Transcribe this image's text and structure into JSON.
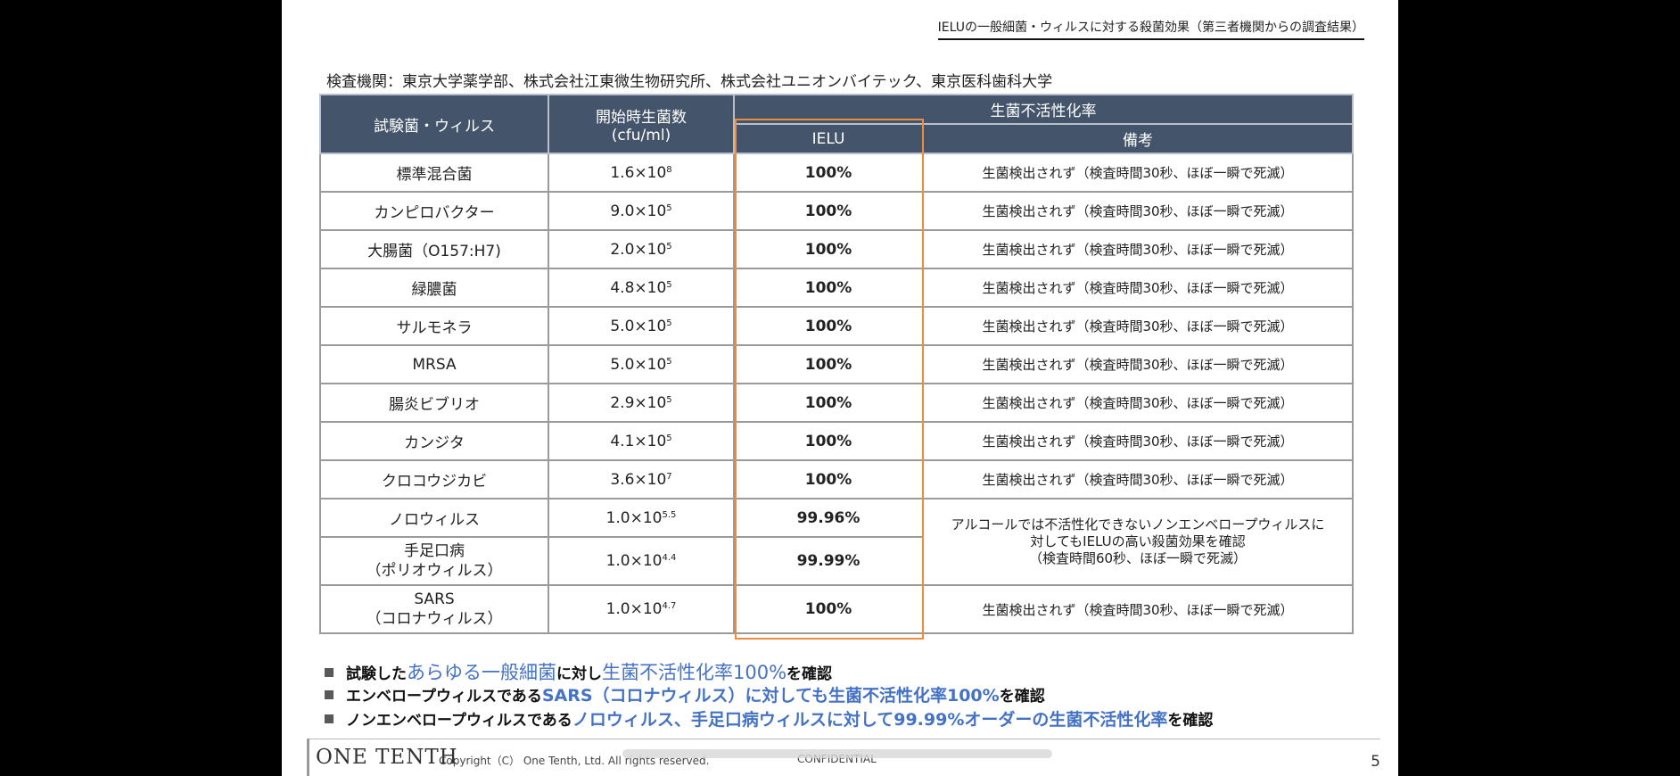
{
  "header": {
    "title": "IELUの一般細菌・ウィルスに対する殺菌効果（第三者機関からの調査結果）"
  },
  "organizations": "検査機関：東京大学薬学部、株式会社江東微生物研究所、株式会社ユニオンバイテック、東京医科歯科大学",
  "table": {
    "headers": {
      "bacteria": "試験菌・ウィルス",
      "initial_count_line1": "開始時生菌数",
      "initial_count_line2": "(cfu/ml)",
      "inactivation": "生菌不活性化率",
      "ielu": "IELU",
      "remarks": "備考"
    },
    "rows": [
      {
        "name": "標準混合菌",
        "coef": "1.6",
        "exp": "8",
        "rate": "100%",
        "note": "生菌検出されず（検査時間30秒、ほぼ一瞬で死滅）"
      },
      {
        "name": "カンピロバクター",
        "coef": "9.0",
        "exp": "5",
        "rate": "100%",
        "note": "生菌検出されず（検査時間30秒、ほぼ一瞬で死滅）"
      },
      {
        "name": "大腸菌（O157:H7)",
        "coef": "2.0",
        "exp": "5",
        "rate": "100%",
        "note": "生菌検出されず（検査時間30秒、ほぼ一瞬で死滅）"
      },
      {
        "name": "緑膿菌",
        "coef": "4.8",
        "exp": "5",
        "rate": "100%",
        "note": "生菌検出されず（検査時間30秒、ほぼ一瞬で死滅）"
      },
      {
        "name": "サルモネラ",
        "coef": "5.0",
        "exp": "5",
        "rate": "100%",
        "note": "生菌検出されず（検査時間30秒、ほぼ一瞬で死滅）"
      },
      {
        "name": "MRSA",
        "coef": "5.0",
        "exp": "5",
        "rate": "100%",
        "note": "生菌検出されず（検査時間30秒、ほぼ一瞬で死滅）"
      },
      {
        "name": "腸炎ビブリオ",
        "coef": "2.9",
        "exp": "5",
        "rate": "100%",
        "note": "生菌検出されず（検査時間30秒、ほぼ一瞬で死滅）"
      },
      {
        "name": "カンジタ",
        "coef": "4.1",
        "exp": "5",
        "rate": "100%",
        "note": "生菌検出されず（検査時間30秒、ほぼ一瞬で死滅）"
      },
      {
        "name": "クロコウジカビ",
        "coef": "3.6",
        "exp": "7",
        "rate": "100%",
        "note": "生菌検出されず（検査時間30秒、ほぼ一瞬で死滅）"
      },
      {
        "name": "ノロウィルス",
        "coef": "1.0",
        "exp": "5.5",
        "rate": "99.96%"
      },
      {
        "name_line1": "手足口病",
        "name_line2": "（ポリオウィルス）",
        "coef": "1.0",
        "exp": "4.4",
        "rate": "99.99%"
      },
      {
        "name_line1": "SARS",
        "name_line2": "（コロナウィルス）",
        "coef": "1.0",
        "exp": "4.7",
        "rate": "100%",
        "note": "生菌検出されず（検査時間30秒、ほぼ一瞬で死滅）"
      }
    ],
    "times": "×10",
    "merged_note": {
      "line1": "アルコールでは不活性化できないノンエンベロープウィルスに",
      "line2": "対してもIELUの高い殺菌効果を確認",
      "line3": "（検査時間60秒、ほぼ一瞬で死滅）"
    }
  },
  "bullets": [
    {
      "p1": "試験した",
      "e1": "あらゆる一般細菌",
      "p2": "に対し",
      "e2": "生菌不活性化率100%",
      "p3": "を確認"
    },
    {
      "p1": "エンベロープウィルスである",
      "e1": "SARS（コロナウィルス）に対しても生菌不活性化率100%",
      "p2": "を確認"
    },
    {
      "p1": "ノンエンベロープウィルスである",
      "e1": "ノロウィルス、手足口病ウィルスに対して99.99%オーダーの生菌不活性化率",
      "p2": "を確認"
    }
  ],
  "footer": {
    "logo": "ONE TENTH",
    "copyright": "Copyright（C） One Tenth, Ltd. All rights reserved.",
    "confidential": "CONFIDENTIAL",
    "page": "5"
  },
  "colors": {
    "header_bg": "#44546a",
    "highlight_border": "#ed8c3a",
    "accent_text": "#4472c4"
  }
}
